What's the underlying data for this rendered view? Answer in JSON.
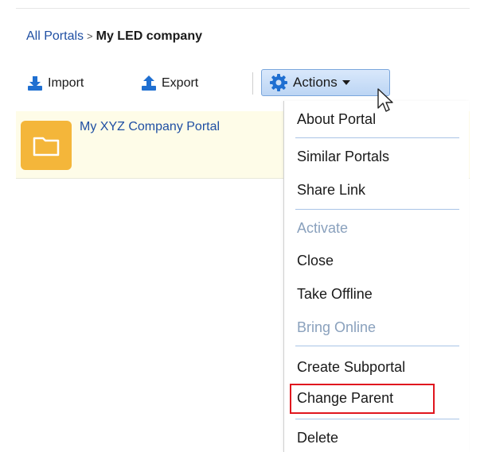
{
  "breadcrumb": {
    "root": "All Portals",
    "separator": ">",
    "current": "My LED company"
  },
  "toolbar": {
    "import_label": "Import",
    "export_label": "Export",
    "actions_label": "Actions",
    "accent_color": "#1f6fd1"
  },
  "portal": {
    "name": "My XYZ Company Portal",
    "folder_color": "#f4b63a"
  },
  "menu": {
    "items": [
      {
        "label": "About Portal",
        "enabled": true
      },
      {
        "label": "Similar Portals",
        "enabled": true
      },
      {
        "label": "Share Link",
        "enabled": true
      },
      {
        "label": "Activate",
        "enabled": false
      },
      {
        "label": "Close",
        "enabled": true
      },
      {
        "label": "Take Offline",
        "enabled": true
      },
      {
        "label": "Bring Online",
        "enabled": false
      },
      {
        "label": "Create Subportal",
        "enabled": true
      },
      {
        "label": "Change Parent",
        "enabled": true,
        "highlighted": true
      },
      {
        "label": "Delete",
        "enabled": true
      }
    ],
    "highlight_color": "#e0161e"
  }
}
